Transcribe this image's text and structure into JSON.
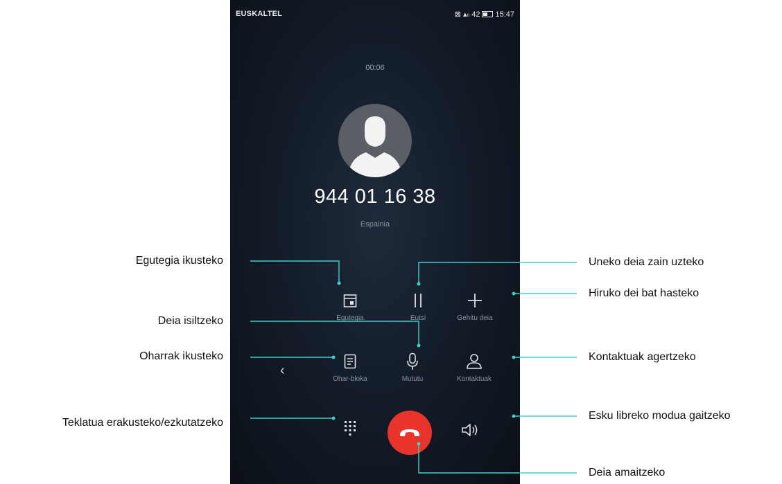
{
  "status_bar": {
    "carrier": "EUSKALTEL",
    "indicators": "⊠ ▴ₗₗ 42",
    "time": "15:47"
  },
  "call": {
    "duration": "00:06",
    "number": "944 01 16 38",
    "location": "Espainia"
  },
  "buttons": {
    "calendar": {
      "label": "Egutegia",
      "icon": "calendar-icon"
    },
    "hold": {
      "label": "Eutsi",
      "icon": "pause-icon"
    },
    "add_call": {
      "label": "Gehitu deia",
      "icon": "plus-icon"
    },
    "notepad": {
      "label": "Ohar-bloka",
      "icon": "notepad-icon"
    },
    "mute": {
      "label": "Mututu",
      "icon": "microphone-icon"
    },
    "contacts": {
      "label": "Kontaktuak",
      "icon": "person-icon"
    }
  },
  "annotations": {
    "calendar": "Egutegia ikusteko",
    "mute": "Deia isiltzeko",
    "notes": "Oharrak ikusteko",
    "keypad": "Teklatua erakusteko/ezkutatzeko",
    "hold": "Uneko deia zain uzteko",
    "three_way": "Hiruko dei bat hasteko",
    "contacts": "Kontaktuak agertzeko",
    "handsfree": "Esku libreko modua gaitzeko",
    "end_call": "Deia amaitzeko"
  },
  "colors": {
    "end_call": "#e8342b",
    "leader_line": "#3fd0c9",
    "background": "#121a26"
  }
}
